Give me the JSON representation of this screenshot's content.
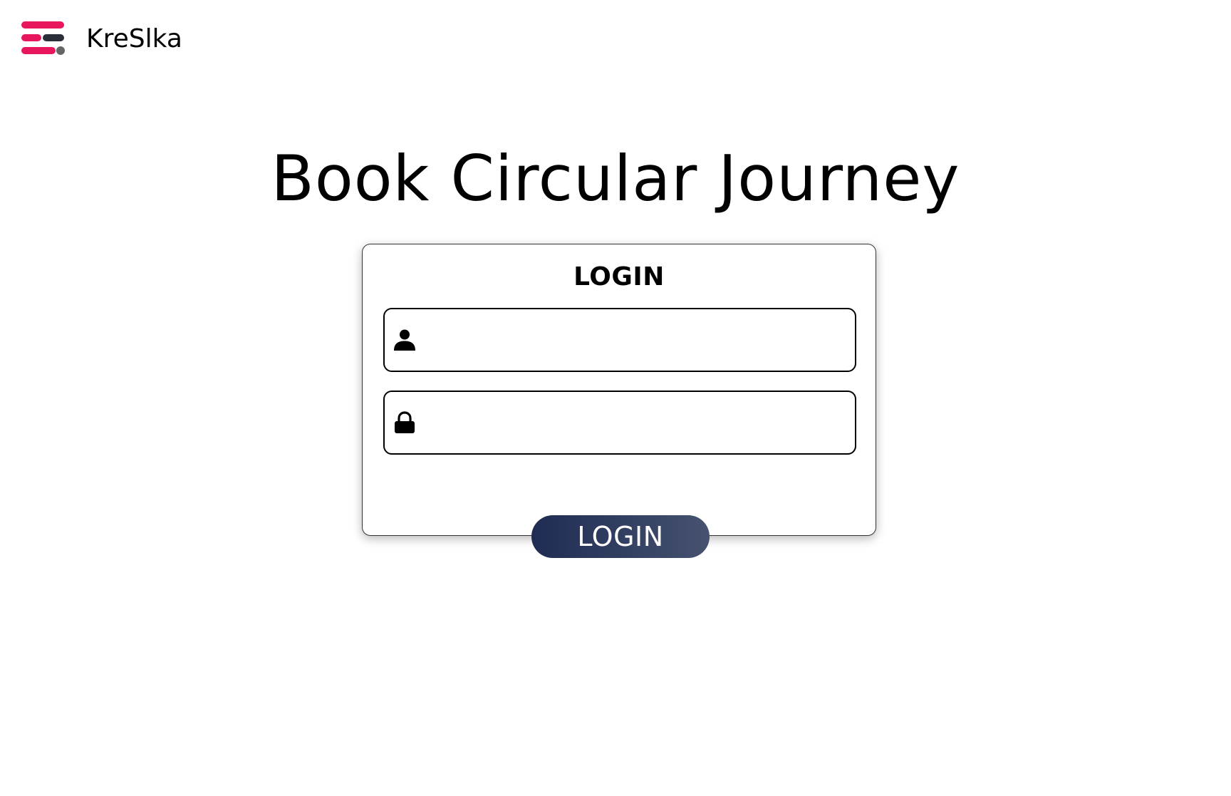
{
  "brand": {
    "name": "KreSlka",
    "logo_icon": "kreslka-logo-icon",
    "colors": {
      "primary": "#e8175d",
      "secondary": "#2b2f3a",
      "dot": "#666666"
    }
  },
  "page": {
    "title": "Book Circular Journey"
  },
  "login_form": {
    "heading": "LOGIN",
    "username": {
      "icon": "user-icon",
      "value": "",
      "placeholder": ""
    },
    "password": {
      "icon": "lock-icon",
      "value": "",
      "placeholder": ""
    },
    "submit_label": "LOGIN",
    "button_gradient": [
      "#1f2b52",
      "#46526f"
    ]
  }
}
